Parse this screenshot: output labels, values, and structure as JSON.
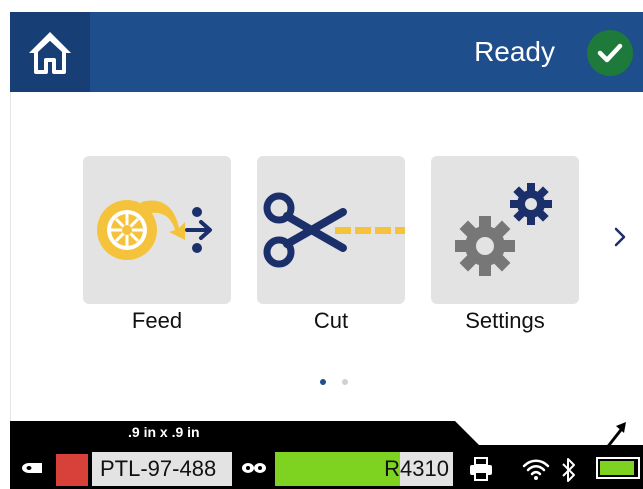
{
  "header": {
    "status_text": "Ready",
    "status_icon": "check-circle-icon",
    "home_icon": "home-icon"
  },
  "tiles": [
    {
      "label": "Feed",
      "icon": "feed-icon"
    },
    {
      "label": "Cut",
      "icon": "scissors-icon"
    },
    {
      "label": "Settings",
      "icon": "gears-icon"
    }
  ],
  "pager": {
    "current_page": 1,
    "total_pages": 2,
    "next_icon": "chevron-right-icon"
  },
  "status_bar": {
    "label_size": ".9 in x .9 in",
    "label_part": "PTL-97-488",
    "label_color": "#d8403a",
    "ribbon_part": "R4310",
    "ribbon_level": 0.7,
    "battery_level": 0.95
  },
  "colors": {
    "header_bg": "#1f4e8c",
    "home_bg": "#173f75",
    "ready_green": "#1e7a3a",
    "accent_yellow": "#f5c33b",
    "accent_navy": "#1b2f6b",
    "level_green": "#7ed321"
  }
}
